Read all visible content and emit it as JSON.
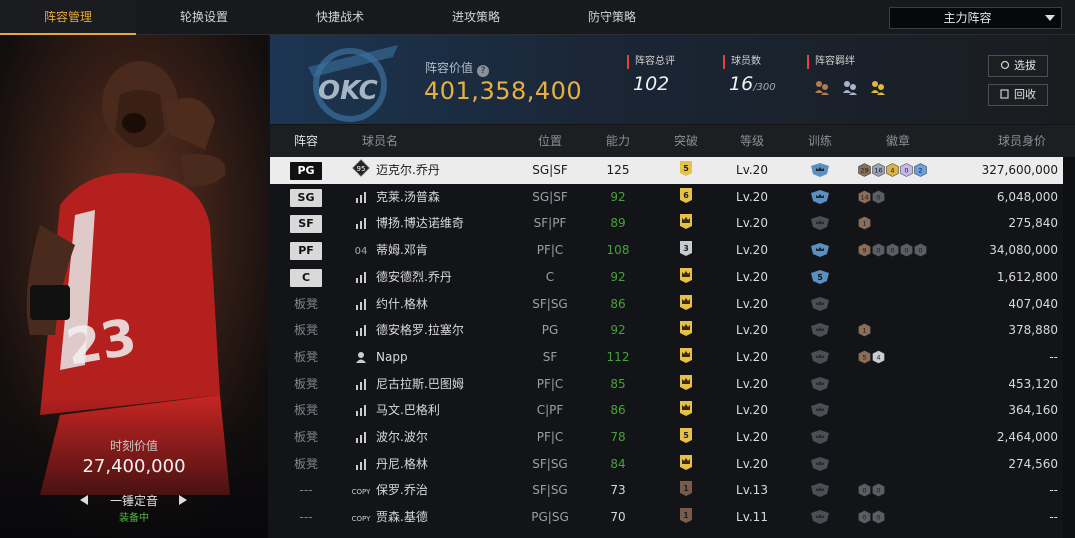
{
  "nav": {
    "tabs": [
      "阵容管理",
      "轮换设置",
      "快捷战术",
      "进攻策略",
      "防守策略"
    ],
    "active_tab": "阵容管理",
    "lineup_selector": "主力阵容"
  },
  "featured_player": {
    "moment_label": "时刻价值",
    "moment_value": "27,400,000",
    "skill_name": "一锤定音",
    "skill_status": "装备中",
    "jersey_number": "23"
  },
  "summary": {
    "value_label": "阵容价值",
    "value": "401,358,400",
    "rating_label": "阵容总评",
    "rating": "102",
    "count_label": "球员数",
    "count": "16",
    "count_max": "/300",
    "bond_label": "阵容羁绊",
    "btn_select": "选拔",
    "btn_recycle": "回收",
    "team_logo_text": "OKC"
  },
  "table": {
    "headers": [
      "阵容",
      "球员名",
      "位置",
      "能力",
      "突破",
      "等级",
      "训练",
      "徽章",
      "球员身价"
    ],
    "rows": [
      {
        "slot": "PG",
        "type": "starter",
        "level_icon": "95",
        "name": "迈克尔.乔丹",
        "pos": "SG|SF",
        "ability": "125",
        "ability_green": false,
        "breakthrough": "5",
        "bt_style": "gold",
        "level": "Lv.20",
        "training": "blue",
        "badges": [
          {
            "t": "29",
            "c": "#8b6e5a"
          },
          {
            "t": "16",
            "c": "#9aa3b5"
          },
          {
            "t": "4",
            "c": "#d9b24a"
          },
          {
            "t": "0",
            "c": "#c8b8e8"
          },
          {
            "t": "2",
            "c": "#6aa0e0"
          }
        ],
        "value": "327,600,000",
        "selected": true
      },
      {
        "slot": "SG",
        "type": "starter",
        "level_icon": "bars",
        "name": "克莱.汤普森",
        "pos": "SG|SF",
        "ability": "92",
        "ability_green": true,
        "breakthrough": "6",
        "bt_style": "gold",
        "level": "Lv.20",
        "training": "blue",
        "badges": [
          {
            "t": "14",
            "c": "#8b6e5a"
          },
          {
            "t": "0",
            "c": "#5a5f66"
          }
        ],
        "value": "6,048,000",
        "selected": false
      },
      {
        "slot": "SF",
        "type": "starter",
        "level_icon": "bars",
        "name": "博扬.博达诺维奇",
        "pos": "SF|PF",
        "ability": "89",
        "ability_green": true,
        "breakthrough": "crown",
        "bt_style": "gold",
        "level": "Lv.20",
        "training": "grey",
        "badges": [
          {
            "t": "1",
            "c": "#8b6e5a"
          }
        ],
        "value": "275,840",
        "selected": false
      },
      {
        "slot": "PF",
        "type": "starter",
        "level_icon": "04",
        "name": "蒂姆.邓肯",
        "pos": "PF|C",
        "ability": "108",
        "ability_green": true,
        "breakthrough": "3",
        "bt_style": "silver",
        "level": "Lv.20",
        "training": "blue",
        "badges": [
          {
            "t": "9",
            "c": "#8b6e5a"
          },
          {
            "t": "0",
            "c": "#5a5f66"
          },
          {
            "t": "0",
            "c": "#5a5f66"
          },
          {
            "t": "0",
            "c": "#5a5f66"
          },
          {
            "t": "0",
            "c": "#5a5f66"
          }
        ],
        "value": "34,080,000",
        "selected": false
      },
      {
        "slot": "C",
        "type": "starter",
        "level_icon": "bars",
        "name": "德安德烈.乔丹",
        "pos": "C",
        "ability": "92",
        "ability_green": true,
        "breakthrough": "crown",
        "bt_style": "gold",
        "level": "Lv.20",
        "training": "blue5",
        "badges": [],
        "value": "1,612,800",
        "selected": false
      },
      {
        "slot": "板凳",
        "type": "bench",
        "level_icon": "bars",
        "name": "约什.格林",
        "pos": "SF|SG",
        "ability": "86",
        "ability_green": true,
        "breakthrough": "crown",
        "bt_style": "gold",
        "level": "Lv.20",
        "training": "grey",
        "badges": [],
        "value": "407,040",
        "selected": false
      },
      {
        "slot": "板凳",
        "type": "bench",
        "level_icon": "bars",
        "name": "德安格罗.拉塞尔",
        "pos": "PG",
        "ability": "92",
        "ability_green": true,
        "breakthrough": "crown",
        "bt_style": "gold",
        "level": "Lv.20",
        "training": "grey",
        "badges": [
          {
            "t": "1",
            "c": "#8b6e5a"
          }
        ],
        "value": "378,880",
        "selected": false
      },
      {
        "slot": "板凳",
        "type": "bench",
        "level_icon": "user",
        "name": "Napp",
        "pos": "SF",
        "ability": "112",
        "ability_green": true,
        "breakthrough": "crown",
        "bt_style": "gold",
        "level": "Lv.20",
        "training": "grey",
        "badges": [
          {
            "t": "5",
            "c": "#8b6e5a"
          },
          {
            "t": "4",
            "c": "#c9ced6"
          }
        ],
        "value": "--",
        "selected": false
      },
      {
        "slot": "板凳",
        "type": "bench",
        "level_icon": "bars",
        "name": "尼古拉斯.巴图姆",
        "pos": "PF|C",
        "ability": "85",
        "ability_green": true,
        "breakthrough": "crown",
        "bt_style": "gold",
        "level": "Lv.20",
        "training": "grey",
        "badges": [],
        "value": "453,120",
        "selected": false
      },
      {
        "slot": "板凳",
        "type": "bench",
        "level_icon": "bars",
        "name": "马文.巴格利",
        "pos": "C|PF",
        "ability": "86",
        "ability_green": true,
        "breakthrough": "crown",
        "bt_style": "gold",
        "level": "Lv.20",
        "training": "grey",
        "badges": [],
        "value": "364,160",
        "selected": false
      },
      {
        "slot": "板凳",
        "type": "bench",
        "level_icon": "bars",
        "name": "波尔.波尔",
        "pos": "PF|C",
        "ability": "78",
        "ability_green": true,
        "breakthrough": "5",
        "bt_style": "gold",
        "level": "Lv.20",
        "training": "grey",
        "badges": [],
        "value": "2,464,000",
        "selected": false
      },
      {
        "slot": "板凳",
        "type": "bench",
        "level_icon": "bars",
        "name": "丹尼.格林",
        "pos": "SF|SG",
        "ability": "84",
        "ability_green": true,
        "breakthrough": "crown",
        "bt_style": "gold",
        "level": "Lv.20",
        "training": "grey",
        "badges": [],
        "value": "274,560",
        "selected": false
      },
      {
        "slot": "---",
        "type": "none",
        "level_icon": "copy",
        "name": "保罗.乔治",
        "pos": "SF|SG",
        "ability": "73",
        "ability_green": false,
        "breakthrough": "1",
        "bt_style": "bronze",
        "level": "Lv.13",
        "training": "grey",
        "badges": [
          {
            "t": "0",
            "c": "#5a5f66"
          },
          {
            "t": "0",
            "c": "#5a5f66"
          }
        ],
        "value": "--",
        "selected": false
      },
      {
        "slot": "---",
        "type": "none",
        "level_icon": "copy",
        "name": "贾森.基德",
        "pos": "PG|SG",
        "ability": "70",
        "ability_green": false,
        "breakthrough": "1",
        "bt_style": "bronze",
        "level": "Lv.11",
        "training": "grey",
        "badges": [
          {
            "t": "0",
            "c": "#5a5f66"
          },
          {
            "t": "0",
            "c": "#5a5f66"
          }
        ],
        "value": "--",
        "selected": false
      }
    ]
  },
  "colors": {
    "accent": "#e8a83a",
    "value_gold": "#e8b040",
    "green": "#47a23b",
    "red_marker": "#e2443b"
  }
}
